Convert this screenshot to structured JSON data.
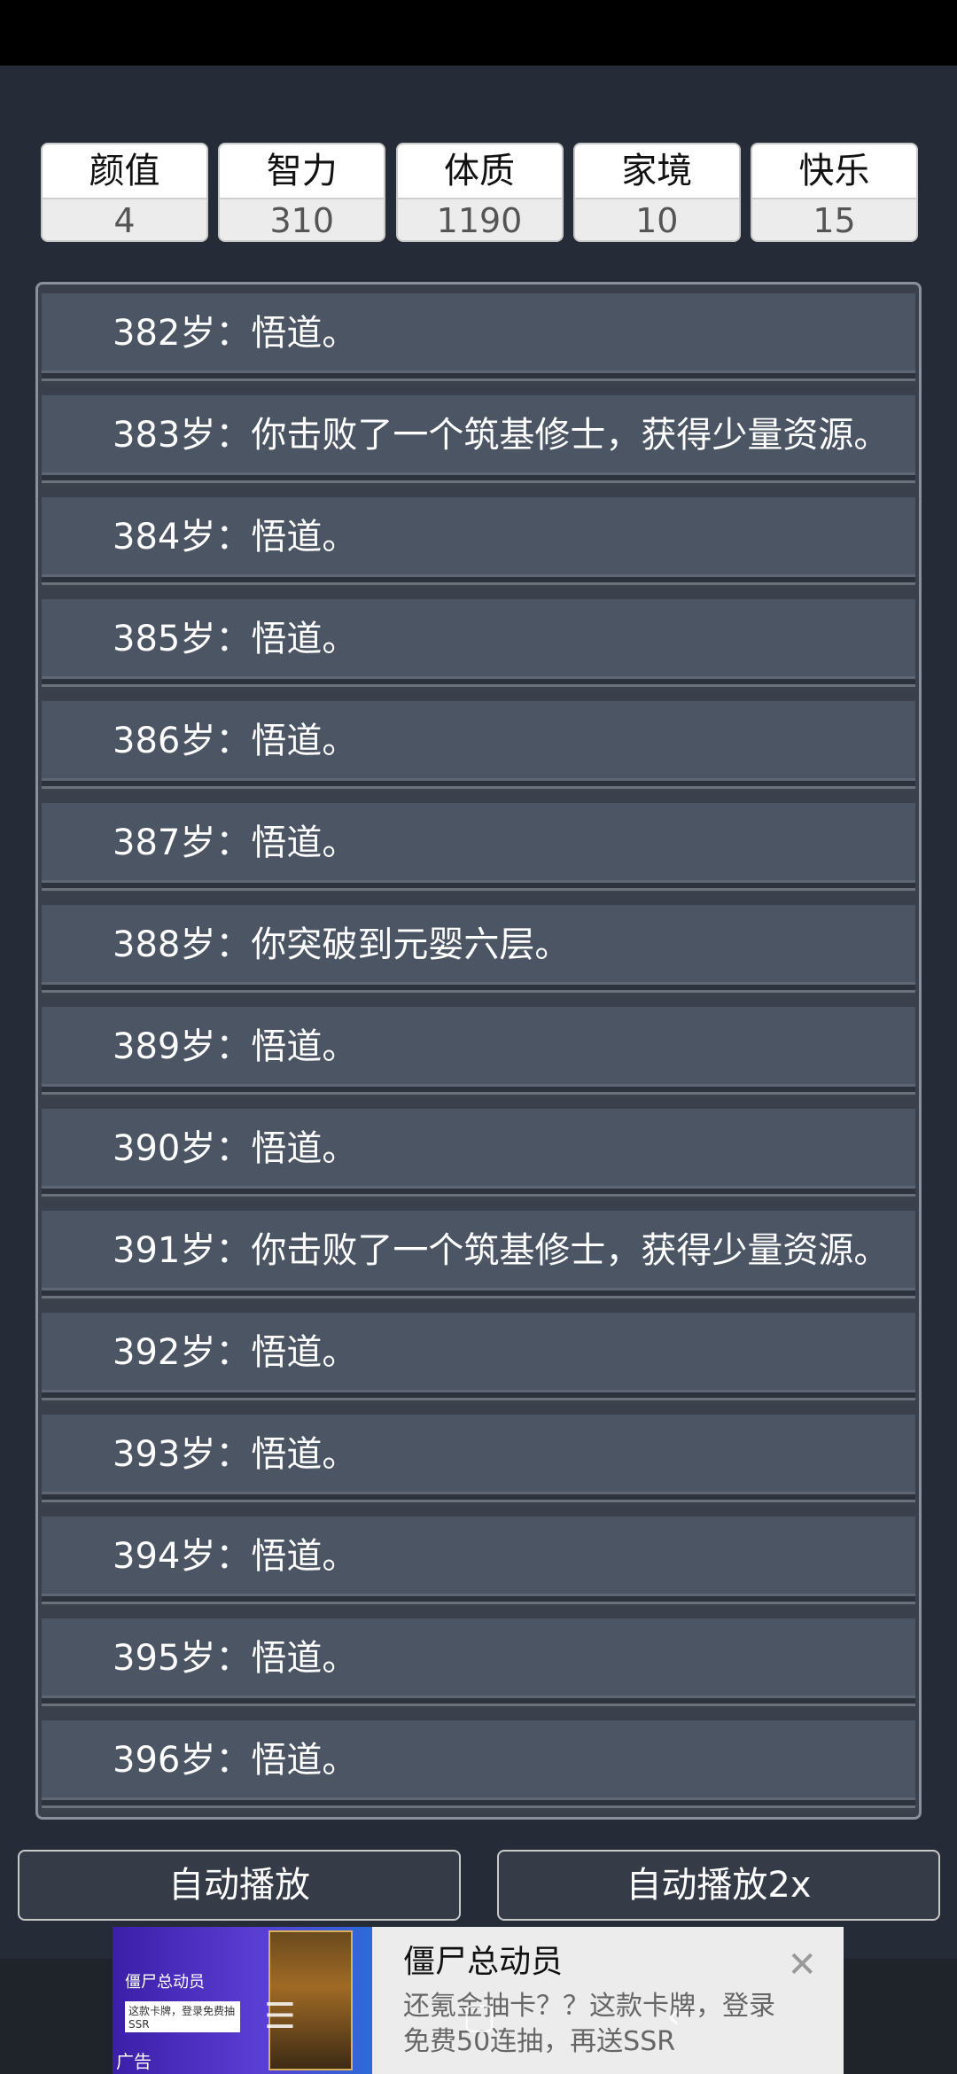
{
  "stats": [
    {
      "label": "颜值",
      "value": "4"
    },
    {
      "label": "智力",
      "value": "310"
    },
    {
      "label": "体质",
      "value": "1190"
    },
    {
      "label": "家境",
      "value": "10"
    },
    {
      "label": "快乐",
      "value": "15"
    }
  ],
  "log": [
    "382岁：悟道。",
    "383岁：你击败了一个筑基修士，获得少量资源。",
    "384岁：悟道。",
    "385岁：悟道。",
    "386岁：悟道。",
    "387岁：悟道。",
    "388岁：你突破到元婴六层。",
    "389岁：悟道。",
    "390岁：悟道。",
    "391岁：你击败了一个筑基修士，获得少量资源。",
    "392岁：悟道。",
    "393岁：悟道。",
    "394岁：悟道。",
    "395岁：悟道。",
    "396岁：悟道。"
  ],
  "buttons": {
    "auto_play": "自动播放",
    "auto_play_2x": "自动播放2x"
  },
  "ad": {
    "thumb_title": "僵尸总动员",
    "thumb_sub": "这款卡牌，登录免费抽SSR",
    "label": "广告",
    "title": "僵尸总动员",
    "description": "还氪金抽卡？？这款卡牌，登录免费50连抽，再送SSR",
    "close_icon": "close-icon"
  },
  "nav": {
    "menu_icon": "menu-icon",
    "home_icon": "home-icon",
    "back_icon": "back-icon"
  }
}
